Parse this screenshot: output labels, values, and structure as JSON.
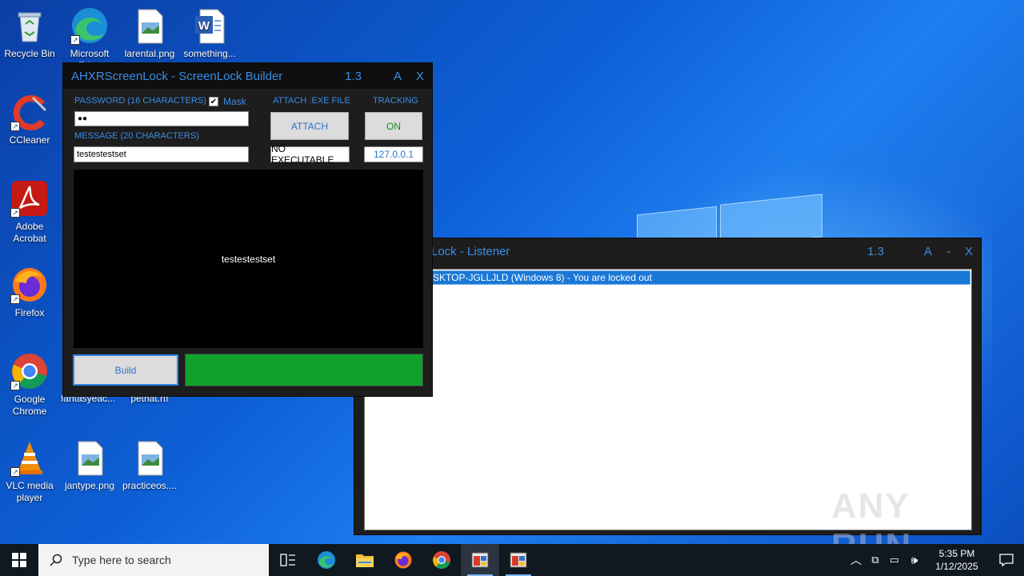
{
  "desktop": {
    "icons_col1": [
      {
        "label": "Recycle Bin"
      },
      {
        "label": "CCleaner"
      },
      {
        "label": "Adobe Acrobat"
      },
      {
        "label": "Firefox"
      },
      {
        "label": "Google Chrome"
      },
      {
        "label": "VLC media player"
      }
    ],
    "icons_top": [
      {
        "label": "Microsoft Edge"
      },
      {
        "label": "larental.png"
      },
      {
        "label": "something..."
      }
    ],
    "icons_bottom": [
      {
        "label": "jantype.png"
      },
      {
        "label": "practiceos...."
      }
    ],
    "hidden_labels": [
      "fantasyeac...",
      "pethat.rtf"
    ]
  },
  "builder": {
    "title": "AHXRScreenLock - ScreenLock Builder",
    "version": "1.3",
    "btn_a": "A",
    "btn_close": "X",
    "password_label": "PASSWORD (16 CHARACTERS)",
    "mask_label": "Mask",
    "password_value": "●●",
    "message_label": "MESSAGE (20 CHARACTERS)",
    "message_value": "testestestset",
    "attach_label": "ATTACH .EXE FILE",
    "attach_button": "ATTACH",
    "attach_status": "NO EXECUTABLE",
    "tracking_label": "TRACKING",
    "tracking_button": "ON",
    "tracking_ip": "127.0.0.1",
    "preview_text": "testestestset",
    "build_button": "Build",
    "progress": 1.0
  },
  "listener": {
    "title": "Lock - Listener",
    "version": "1.3",
    "btn_a": "A",
    "btn_min": "-",
    "btn_close": "X",
    "entries": [
      "SKTOP-JGLLJLD (Windows 8) - You are locked out"
    ]
  },
  "watermark": "ANY RUN",
  "taskbar": {
    "search_placeholder": "Type here to search",
    "time": "5:35 PM",
    "date": "1/12/2025"
  },
  "colors": {
    "accent_blue": "#3b8de6",
    "progress_green": "#10a22a",
    "selection_blue": "#1a78d6"
  }
}
